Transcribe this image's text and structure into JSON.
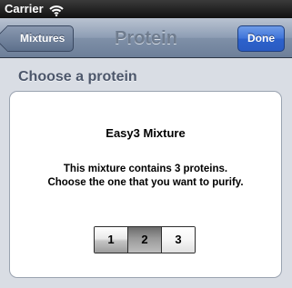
{
  "status_bar": {
    "carrier": "Carrier",
    "wifi_icon": "wifi-icon"
  },
  "nav_bar": {
    "title": "Protein",
    "back_label": "Mixtures",
    "done_label": "Done"
  },
  "section": {
    "header": "Choose a protein"
  },
  "card": {
    "title": "Easy3 Mixture",
    "description": "This mixture contains 3 proteins. Choose the one that you want to purify."
  },
  "segmented": {
    "options": [
      "1",
      "2",
      "3"
    ],
    "selected": "2"
  },
  "colors": {
    "nav_bar": "#8d9db4",
    "done_button": "#3e73d8",
    "background": "#d9dde4"
  }
}
